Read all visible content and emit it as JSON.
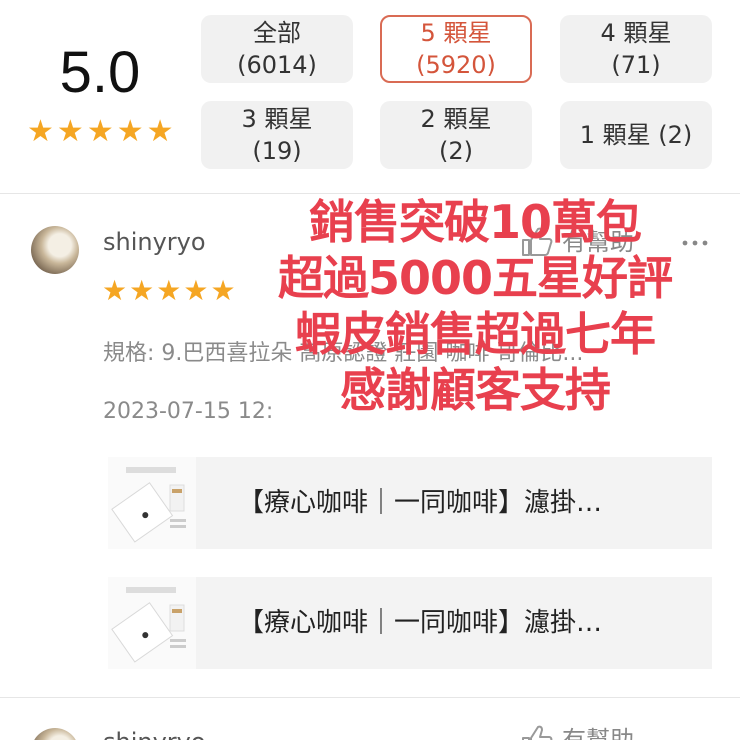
{
  "summary": {
    "score": "5.0",
    "stars": 5,
    "filters": [
      {
        "id": "all",
        "label": "全部",
        "count": "(6014)"
      },
      {
        "id": "5",
        "label": "5 顆星",
        "count": "(5920)",
        "active": true
      },
      {
        "id": "4",
        "label": "4 顆星",
        "count": "(71)"
      },
      {
        "id": "3",
        "label": "3 顆星",
        "count": "(19)"
      },
      {
        "id": "2",
        "label": "2 顆星",
        "count": "(2)"
      },
      {
        "id": "1",
        "label": "1 顆星 (2)"
      }
    ]
  },
  "review": {
    "username": "shinyryo",
    "stars": 5,
    "helpful_label": "有幫助",
    "variation": "規格: 9.巴西喜拉朵 高原認證 莊園 咖啡 哥倫比...",
    "date": "2023-07-15 12:",
    "products": [
      {
        "title": "【療心咖啡｜一同咖啡】濾掛…"
      },
      {
        "title": "【療心咖啡｜一同咖啡】濾掛…"
      }
    ]
  },
  "next_review": {
    "username": "shinyryo",
    "helpful_label": "有幫助"
  },
  "promo": {
    "lines": [
      "銷售突破10萬包",
      "超過5000五星好評",
      "蝦皮銷售超過七年",
      "感謝顧客支持"
    ],
    "color": "#e8404e"
  },
  "colors": {
    "star": "#f5a623",
    "active_filter": "#d4553b"
  },
  "icons": {
    "star": "star-icon",
    "thumb": "thumbs-up-icon",
    "more": "more-icon"
  }
}
